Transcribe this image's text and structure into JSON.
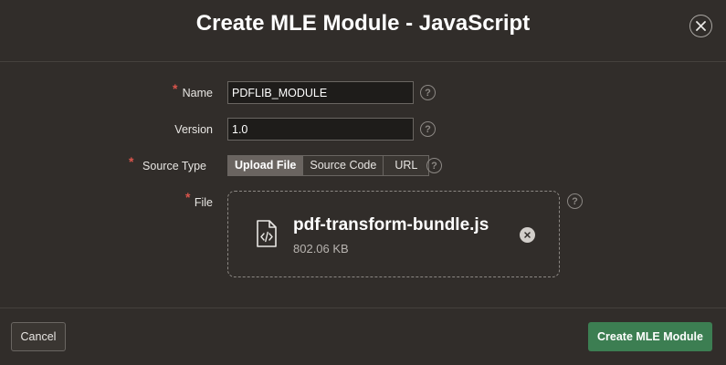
{
  "dialog": {
    "title": "Create MLE Module - JavaScript"
  },
  "form": {
    "name": {
      "label": "Name",
      "value": "PDFLIB_MODULE",
      "required": true
    },
    "version": {
      "label": "Version",
      "value": "1.0",
      "required": false
    },
    "source_type": {
      "label": "Source Type",
      "required": true,
      "options": [
        "Upload File",
        "Source Code",
        "URL"
      ],
      "selected": "Upload File"
    },
    "file": {
      "label": "File",
      "required": true,
      "file_name": "pdf-transform-bundle.js",
      "file_size": "802.06 KB"
    },
    "help_glyph": "?",
    "required_glyph": "*"
  },
  "footer": {
    "cancel_label": "Cancel",
    "create_label": "Create MLE Module"
  },
  "colors": {
    "background": "#312d2a",
    "primary_button": "#3c7e52",
    "required": "#d9544b"
  }
}
